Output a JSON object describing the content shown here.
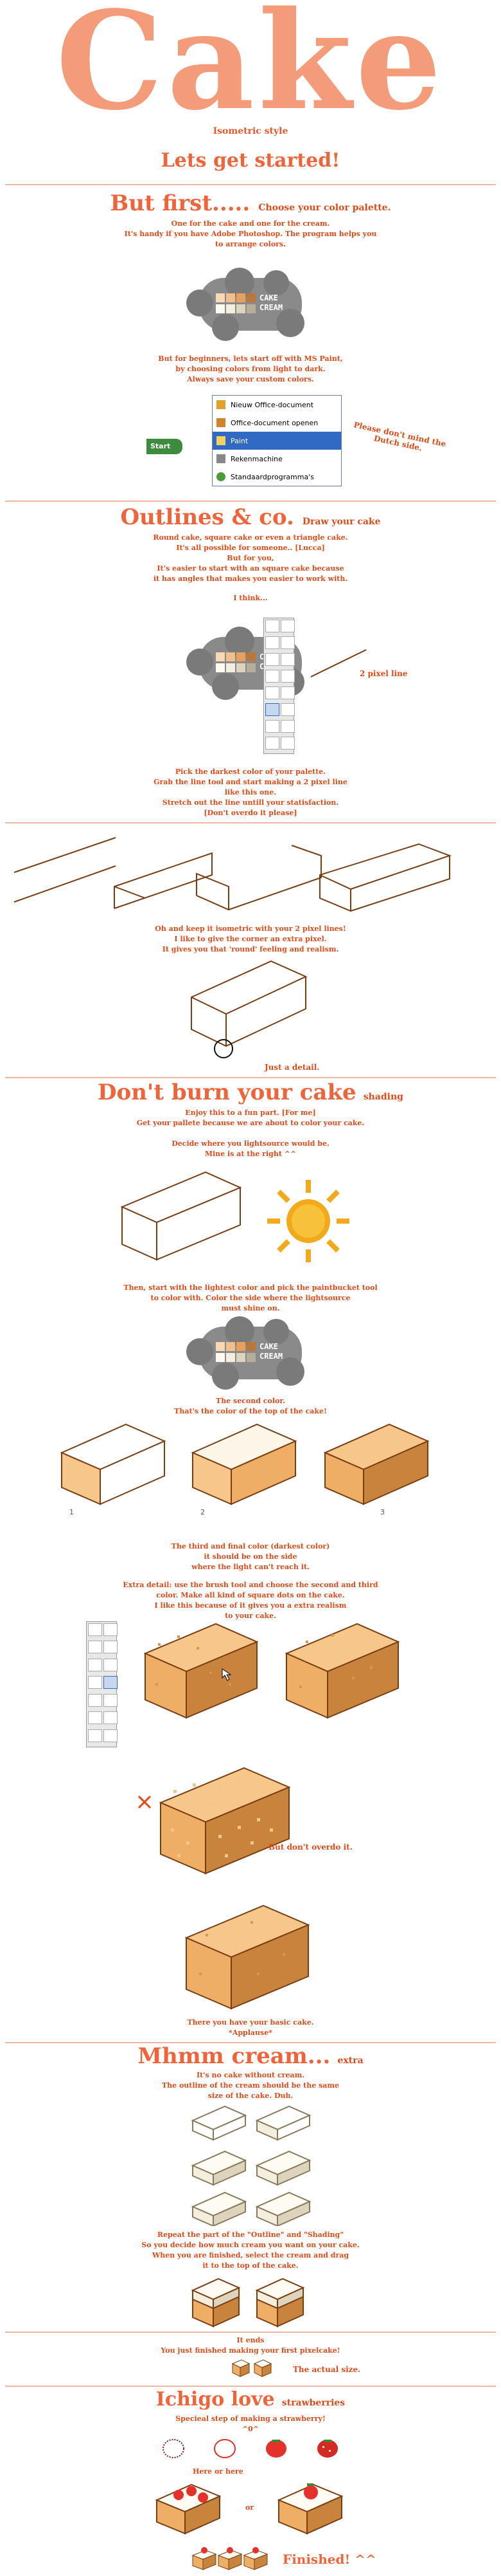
{
  "header": {
    "title": "Cake",
    "style_label": "Isometric style",
    "intro": "Lets get started!"
  },
  "section_palette": {
    "heading": "But first.....",
    "heading_note": "Choose your color palette.",
    "lines": [
      "One for the cake and one for the cream.",
      "It's handy if you have Adobe Photoshop. The program helps you",
      "to arrange colors."
    ],
    "palette_labels": [
      "CAKE",
      "CREAM"
    ],
    "after_lines": [
      "But for beginners, lets start off with MS Paint,",
      "by choosing colors from light to dark.",
      "Always save your custom colors."
    ],
    "menu_items": [
      "Nieuw Office-document",
      "Office-document openen",
      "Paint",
      "Rekenmachine",
      "Standaardprogramma's"
    ],
    "start_label": "Start",
    "side_note": "Please don't mind the Dutch side."
  },
  "section_outlines": {
    "heading": "Outlines & co.",
    "heading_note": "Draw your cake",
    "lines": [
      "Round cake, square cake or even a triangle cake.",
      "It's all possible for someone.. [Lucca]",
      "But for you,",
      "It's easier to start with an square cake because",
      "it has angles that makes you easier to work with."
    ],
    "think": "I think...",
    "pixel_line_label": "2 pixel line",
    "after_lines": [
      "Pick the darkest color of your palette.",
      "Grab the line tool and start making a 2 pixel line",
      "like this one.",
      "Stretch out the line untill your statisfaction.",
      "[Don't overdo it please]"
    ],
    "corner_lines": [
      "Oh and keep it isometric with your 2 pixel lines!",
      "I like to give the corner an extra pixel.",
      "It gives you that 'round' feeling and realism."
    ],
    "detail": "Just a detail."
  },
  "section_shading": {
    "heading": "Don't burn your cake",
    "heading_note": "shading",
    "lines": [
      "Enjoy this to a fun part. [For me]",
      "Get your pallete because we are about to color your cake."
    ],
    "light_lines": [
      "Decide where you lightsource would be.",
      "Mine is at the right ^^"
    ],
    "fill_lines": [
      "Then, start with the lightest color and pick the paintbucket tool",
      "to color with. Color the side where the lightsource",
      "must shine on."
    ],
    "second_lines": [
      "The second color.",
      "That's the color of the top of the cake!"
    ],
    "step_numbers": [
      "1",
      "2",
      "3"
    ],
    "third_lines": [
      "The third and final color (darkest color)",
      "it should be on the side",
      "where the light can't reach it."
    ],
    "extra_lines": [
      "Extra detail: use the brush tool and choose the second and third",
      "color. Make all kind of square dots on the cake.",
      "I like this because of it gives you a extra realism",
      "to your cake."
    ],
    "overdo_note": "But don't overdo it.",
    "basic_lines": [
      "There you have your basic cake.",
      "*Applause*"
    ]
  },
  "section_cream": {
    "heading": "Mhmm cream...",
    "heading_note": "extra",
    "lines": [
      "It's no cake without cream.",
      "The outline of the cream should be the same",
      "size of the cake. Duh."
    ],
    "repeat_lines": [
      "Repeat the part of the \"Outline\" and \"Shading\"",
      "So you decide how much cream you want on your cake.",
      "When you are finished, select the cream and drag",
      "it to the top of the cake."
    ],
    "smile_lines": [
      "It ends",
      "You just finished making your first pixelcake!"
    ],
    "actual_size": "The actual size."
  },
  "section_strawberry": {
    "heading": "Ichigo love",
    "heading_note": "strawberries",
    "lines": [
      "Specieal step of making a strawberry!",
      "^0^"
    ],
    "here_or_here": "Here or here",
    "or_label": "or",
    "finished": "Finished! ^^"
  },
  "colors": {
    "accent": "#e8592a",
    "logo": "#f49b79",
    "divider": "#f6b7a2",
    "cake_light": "#f6c68a",
    "cake_mid": "#eeae66",
    "cake_dark": "#c8843d",
    "cake_outline": "#7a3d12",
    "cream": "#fbf6e8",
    "strawberry": "#e6302b"
  }
}
